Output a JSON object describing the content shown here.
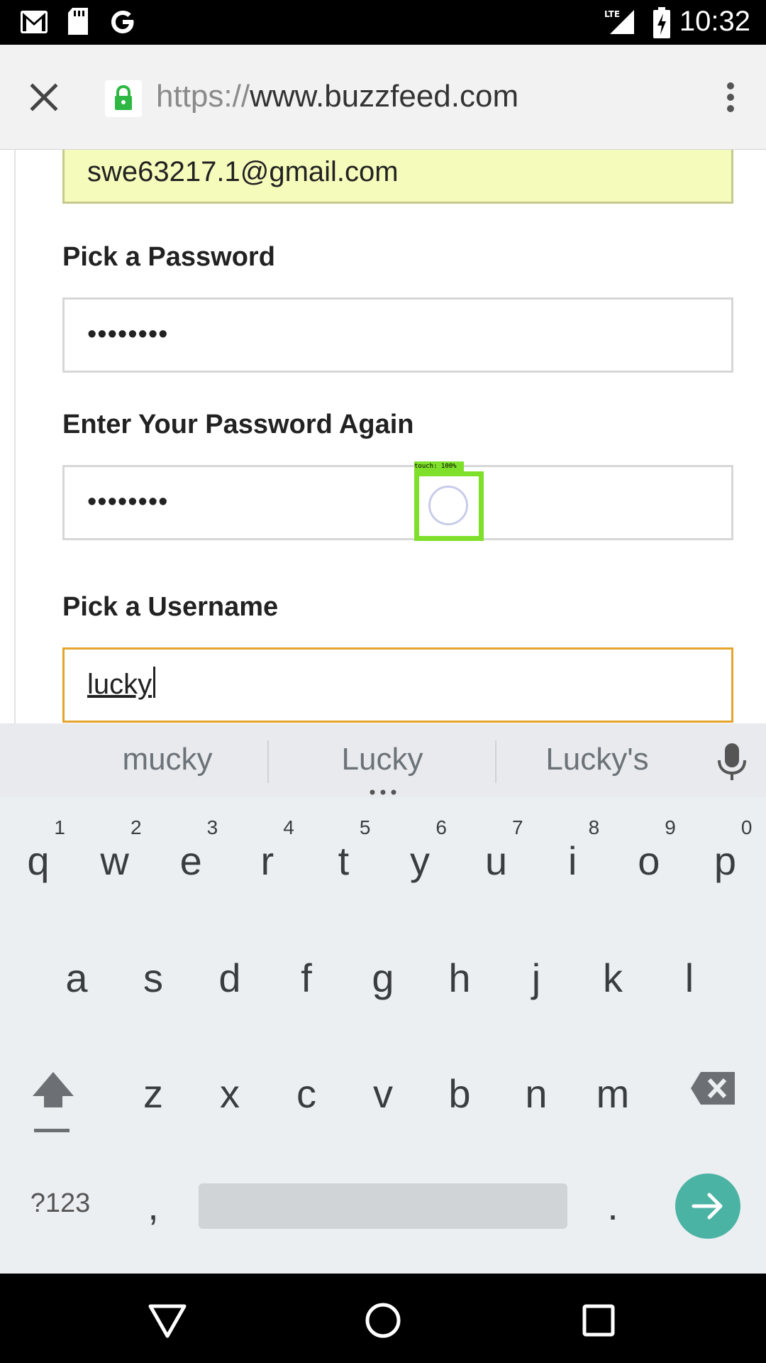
{
  "status_bar": {
    "time": "10:32",
    "left_icons": [
      "gmail-icon",
      "sd-card-icon",
      "google-icon"
    ],
    "right_icons": [
      "lte-signal-icon",
      "battery-charging-icon"
    ],
    "network_label": "LTE"
  },
  "browser": {
    "url_scheme": "https://",
    "url_host": "www.buzzfeed.com",
    "close_icon": "close-icon",
    "menu_icon": "more-vert-icon",
    "secure_color": "#2eb843"
  },
  "form": {
    "email_value": "swe63217.1@gmail.com",
    "password_label": "Pick a Password",
    "password_value": "••••••••",
    "password_again_label": "Enter Your Password Again",
    "password_again_value": "••••••••",
    "username_label": "Pick a Username",
    "username_value": "lucky"
  },
  "touch_overlay": {
    "label": "touch: 100%",
    "color": "#7ee02a"
  },
  "keyboard": {
    "suggestions": [
      "mucky",
      "Lucky",
      "Lucky's"
    ],
    "row1": [
      {
        "ch": "q",
        "num": "1"
      },
      {
        "ch": "w",
        "num": "2"
      },
      {
        "ch": "e",
        "num": "3"
      },
      {
        "ch": "r",
        "num": "4"
      },
      {
        "ch": "t",
        "num": "5"
      },
      {
        "ch": "y",
        "num": "6"
      },
      {
        "ch": "u",
        "num": "7"
      },
      {
        "ch": "i",
        "num": "8"
      },
      {
        "ch": "o",
        "num": "9"
      },
      {
        "ch": "p",
        "num": "0"
      }
    ],
    "row2": [
      "a",
      "s",
      "d",
      "f",
      "g",
      "h",
      "j",
      "k",
      "l"
    ],
    "row3": [
      "z",
      "x",
      "c",
      "v",
      "b",
      "n",
      "m"
    ],
    "symbols_label": "?123",
    "comma": ",",
    "period": ".",
    "accent_color": "#4bb3a4"
  }
}
